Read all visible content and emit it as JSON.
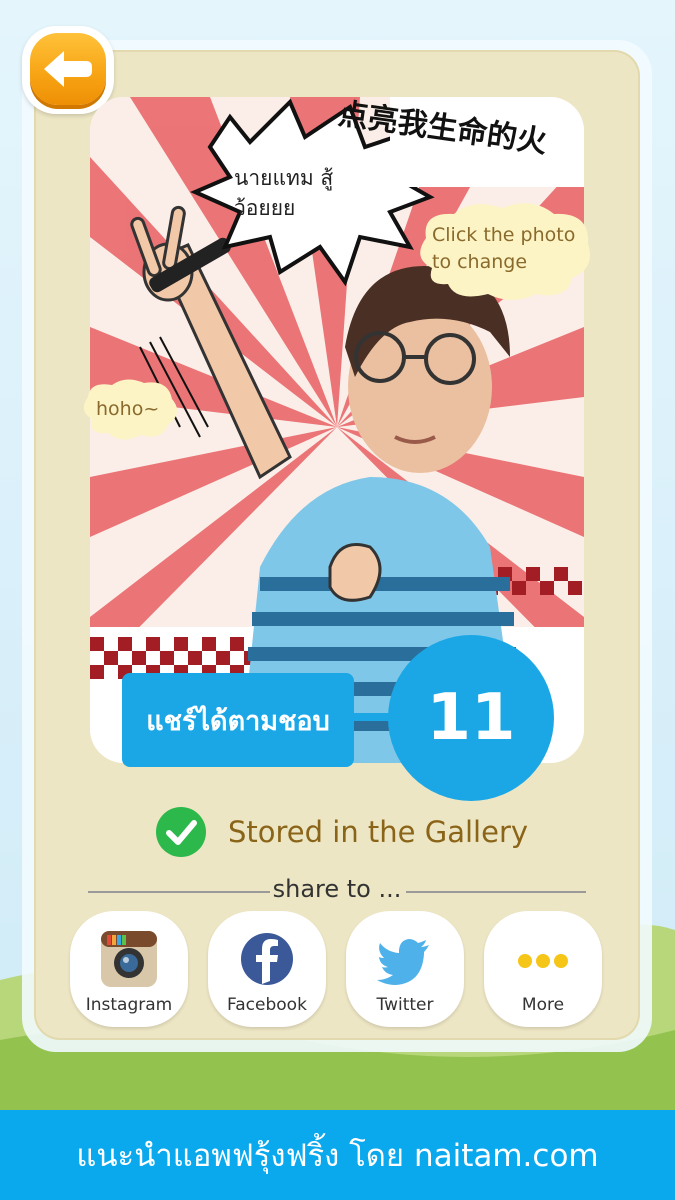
{
  "header": {
    "back_icon": "back-arrow-icon"
  },
  "photo": {
    "speech_bubble_text": "นายแทม สู้ว้อยยย",
    "banner_chinese": "点亮我生命的火",
    "tip_change_photo": "Click the photo to change",
    "tip_hoho": "hoho~"
  },
  "promo": {
    "share_label": "แชร์ได้ตามชอบ",
    "number": "11"
  },
  "status": {
    "stored_text": "Stored in the Gallery",
    "check_icon": "check-circle-icon"
  },
  "share": {
    "heading": "share to ...",
    "buttons": [
      {
        "label": "Instagram",
        "icon": "instagram-icon"
      },
      {
        "label": "Facebook",
        "icon": "facebook-icon"
      },
      {
        "label": "Twitter",
        "icon": "twitter-icon"
      },
      {
        "label": "More",
        "icon": "more-dots-icon"
      }
    ]
  },
  "footer": {
    "text": "แนะนำแอพฟรุ้งฟริ้ง โดย naitam.com"
  },
  "colors": {
    "accent_blue": "#1ba7e6",
    "card_beige": "#ede6c4",
    "back_orange": "#f7a313",
    "check_green": "#2cb84a"
  }
}
